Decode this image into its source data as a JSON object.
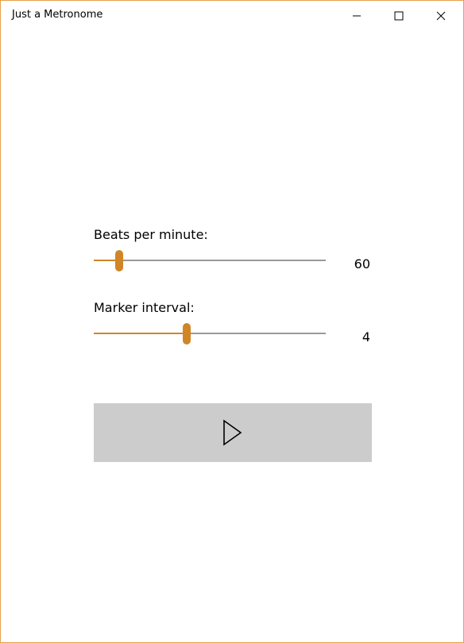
{
  "window": {
    "title": "Just a Metronome",
    "border_color": "#e6a24a",
    "accent_color": "#d08626"
  },
  "caption_buttons": {
    "minimize_icon": "minimize-icon",
    "maximize_icon": "maximize-icon",
    "close_icon": "close-icon"
  },
  "controls": {
    "bpm": {
      "label": "Beats per minute:",
      "value": "60",
      "slider_position": 0.11
    },
    "marker": {
      "label": "Marker interval:",
      "value": "4",
      "slider_position": 0.4
    },
    "play_button": {
      "icon": "play-icon"
    }
  }
}
